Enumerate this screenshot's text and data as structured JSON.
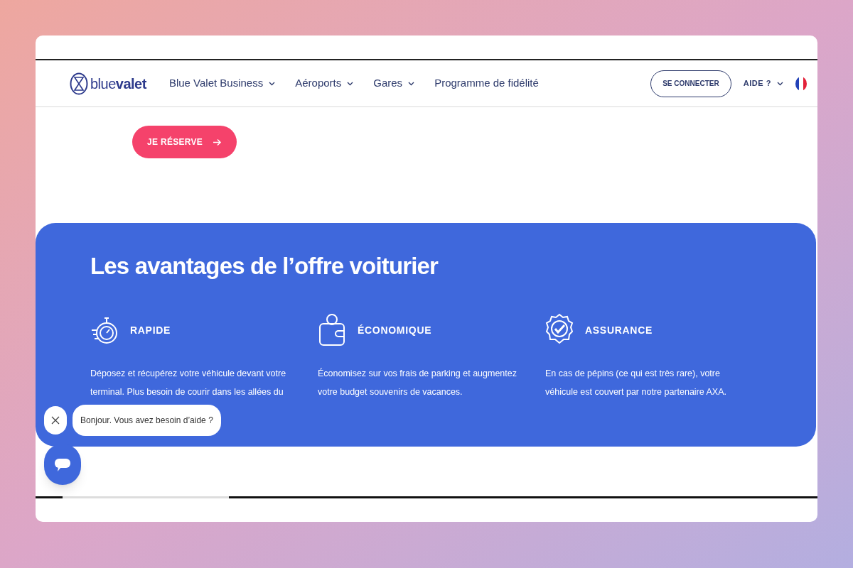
{
  "header": {
    "logo": {
      "light": "blue",
      "bold": "valet"
    },
    "nav": [
      {
        "label": "Blue Valet Business",
        "dropdown": true
      },
      {
        "label": "Aéroports",
        "dropdown": true
      },
      {
        "label": "Gares",
        "dropdown": true
      },
      {
        "label": "Programme de fidélité",
        "dropdown": false
      }
    ],
    "login_button": "SE CONNECTER",
    "help": {
      "label": "AIDE ?",
      "dropdown": true
    }
  },
  "cta_button": "JE RÉSERVE",
  "advantages": {
    "title": "Les avantages de l’offre voiturier",
    "items": [
      {
        "kind": "stopwatch",
        "title": "RAPIDE",
        "text": "Déposez et récupérez votre véhicule devant votre terminal. Plus besoin de courir dans les allées du"
      },
      {
        "kind": "wallet",
        "title": "ÉCONOMIQUE",
        "text": "Économisez sur vos frais de parking et augmentez votre budget souvenirs de vacances."
      },
      {
        "kind": "badge",
        "title": "ASSURANCE",
        "text": "En cas de pépins (ce qui est très rare), votre véhicule est couvert par notre partenaire AXA."
      }
    ]
  },
  "chat": {
    "message": "Bonjour. Vous avez besoin d’aide ?"
  }
}
